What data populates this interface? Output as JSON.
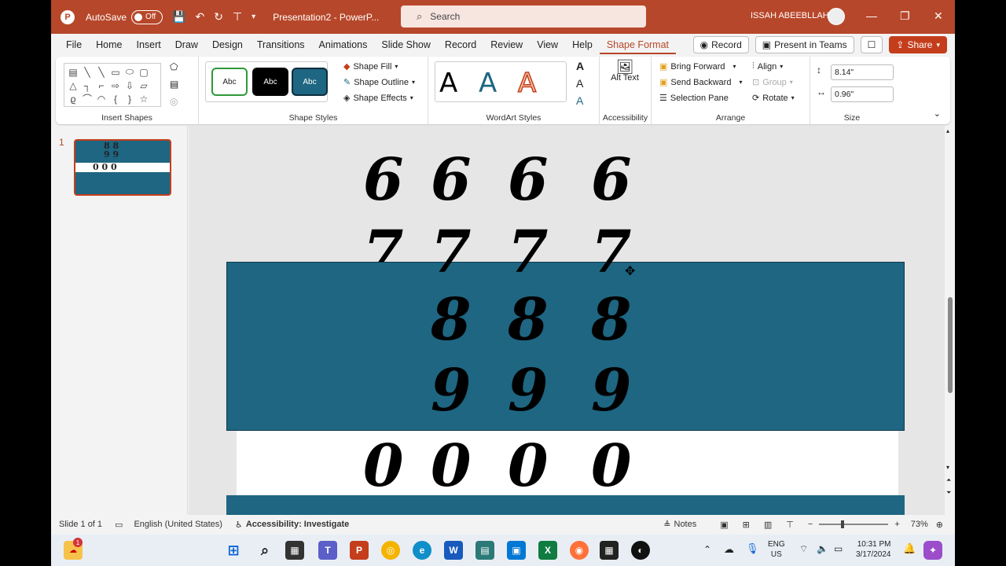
{
  "titlebar": {
    "logo": "P",
    "autosave_label": "AutoSave",
    "autosave_state": "Off",
    "filename": "Presentation2 - PowerP...",
    "search_placeholder": "Search",
    "user_name": "ISSAH ABEEBLLAHI",
    "min": "—",
    "max": "❐",
    "close": "✕"
  },
  "menu": {
    "items": [
      "File",
      "Home",
      "Insert",
      "Draw",
      "Design",
      "Transitions",
      "Animations",
      "Slide Show",
      "Record",
      "Review",
      "View",
      "Help",
      "Shape Format"
    ],
    "active": "Shape Format",
    "record_btn": "Record",
    "present_btn": "Present in Teams",
    "share_btn": "Share"
  },
  "ribbon": {
    "insert_shapes_label": "Insert Shapes",
    "shape_styles_label": "Shape Styles",
    "style_sample": "Abc",
    "shape_fill": "Shape Fill",
    "shape_outline": "Shape Outline",
    "shape_effects": "Shape Effects",
    "wordart_label": "WordArt Styles",
    "wordart_sample": "A",
    "alt_text": "Alt Text",
    "accessibility_label": "Accessibility",
    "bring_forward": "Bring Forward",
    "send_backward": "Send Backward",
    "selection_pane": "Selection Pane",
    "align": "Align",
    "group": "Group",
    "rotate": "Rotate",
    "arrange_label": "Arrange",
    "height": "8.14\"",
    "width": "0.96\"",
    "size_label": "Size"
  },
  "slides": {
    "number": "1",
    "thumb_digits": "8 8\n9 9\n0 0 0"
  },
  "canvas": {
    "row_6": [
      "6",
      "6",
      "6",
      "6"
    ],
    "row_7": [
      "7",
      "7",
      "7",
      "7"
    ],
    "row_8": [
      "8",
      "8",
      "8"
    ],
    "row_9": [
      "9",
      "9",
      "9"
    ],
    "row_0": [
      "0",
      "0",
      "0",
      "0"
    ],
    "accent_color": "#1e6682"
  },
  "status": {
    "slide_info": "Slide 1 of 1",
    "language": "English (United States)",
    "accessibility": "Accessibility: Investigate",
    "notes": "Notes",
    "zoom": "73%"
  },
  "taskbar": {
    "lang_top": "ENG",
    "lang_bottom": "US",
    "time": "10:31 PM",
    "date": "3/17/2024",
    "notification_count": "1"
  }
}
